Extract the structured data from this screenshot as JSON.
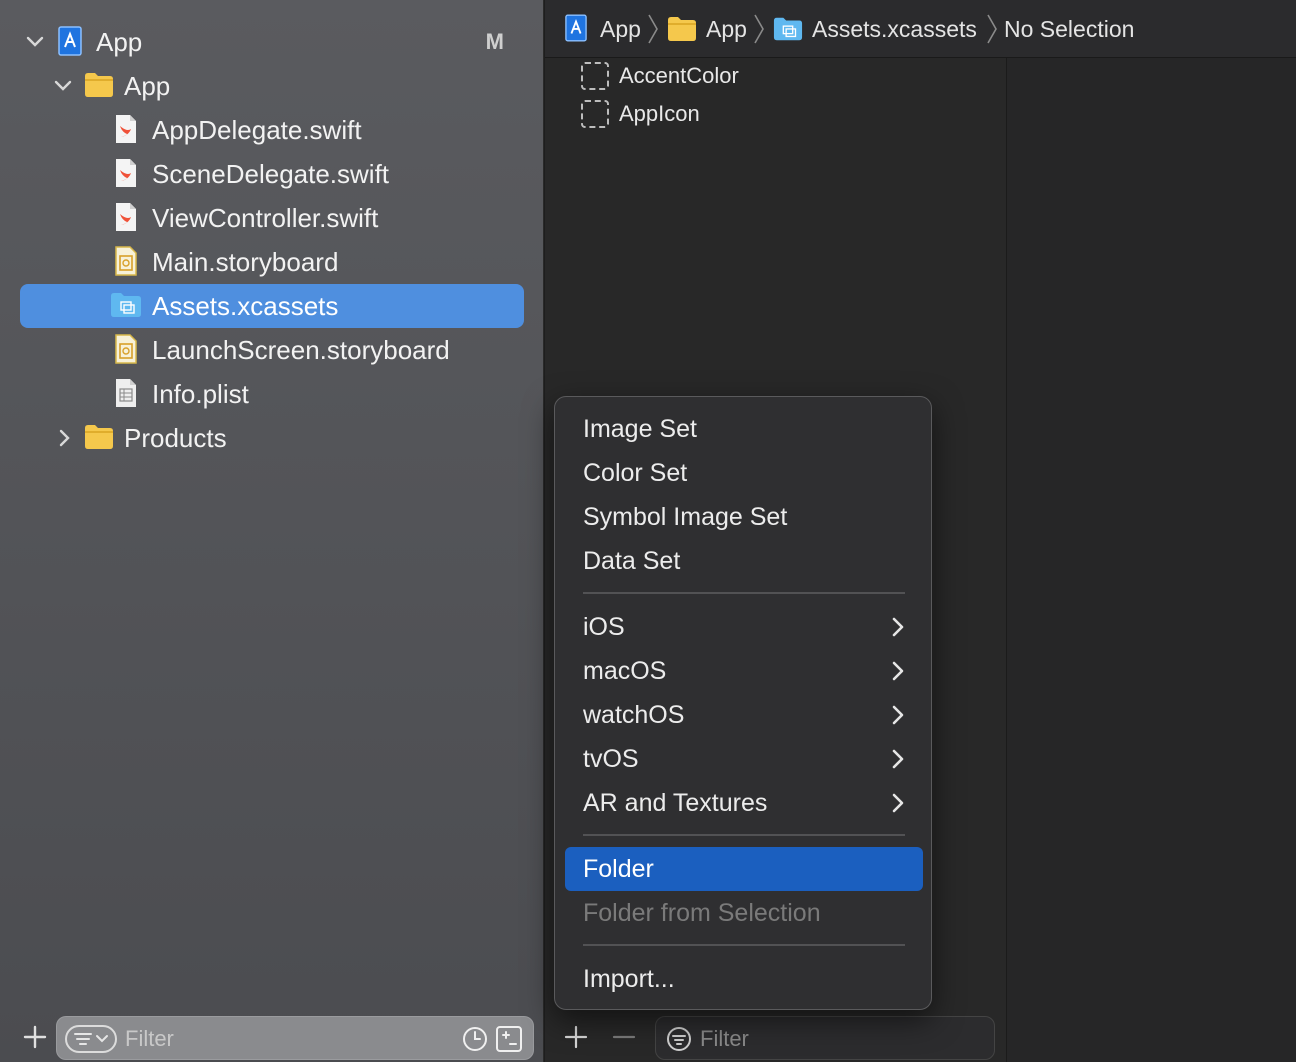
{
  "navigator": {
    "rows": [
      {
        "label": "App",
        "kind": "project",
        "badge": "M"
      },
      {
        "label": "App",
        "kind": "folder"
      },
      {
        "label": "AppDelegate.swift",
        "kind": "swift"
      },
      {
        "label": "SceneDelegate.swift",
        "kind": "swift"
      },
      {
        "label": "ViewController.swift",
        "kind": "swift"
      },
      {
        "label": "Main.storyboard",
        "kind": "storyboard"
      },
      {
        "label": "Assets.xcassets",
        "kind": "xcassets",
        "selected": true
      },
      {
        "label": "LaunchScreen.storyboard",
        "kind": "storyboard"
      },
      {
        "label": "Info.plist",
        "kind": "plist"
      },
      {
        "label": "Products",
        "kind": "folder"
      }
    ],
    "filter_placeholder": "Filter"
  },
  "jumpbar": {
    "crumbs": [
      "App",
      "App",
      "Assets.xcassets",
      "No Selection"
    ]
  },
  "assets": {
    "items": [
      "AccentColor",
      "AppIcon"
    ],
    "filter_placeholder": "Filter"
  },
  "menu": {
    "group1": [
      "Image Set",
      "Color Set",
      "Symbol Image Set",
      "Data Set"
    ],
    "group2": [
      "iOS",
      "macOS",
      "watchOS",
      "tvOS",
      "AR and Textures"
    ],
    "folder": "Folder",
    "folder_from_selection": "Folder from Selection",
    "import": "Import..."
  },
  "colors": {
    "selection": "#4f8fdf",
    "menu_highlight": "#1b5fbf",
    "folder": "#f5c84c",
    "swift": "#f05138",
    "xcassets": "#5fb8f0"
  }
}
